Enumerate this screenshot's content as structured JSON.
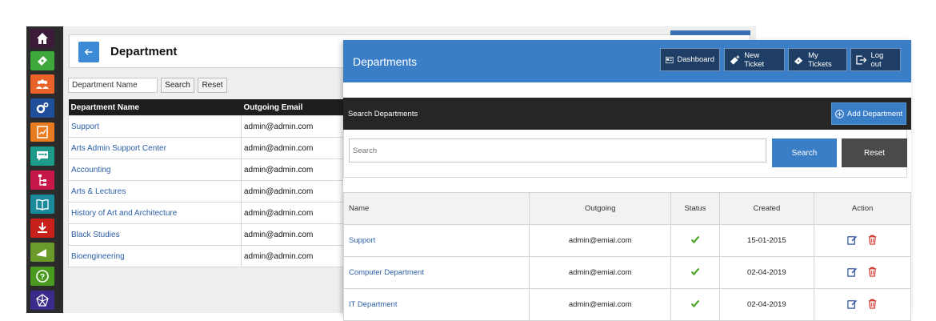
{
  "old_app": {
    "title": "Department",
    "search_placeholder": "Department Name",
    "search_label": "Search",
    "reset_label": "Reset",
    "columns": [
      "Department Name",
      "Outgoing Email"
    ],
    "rows": [
      {
        "name": "Support",
        "email": "admin@admin.com"
      },
      {
        "name": "Arts Admin Support Center",
        "email": "admin@admin.com"
      },
      {
        "name": "Accounting",
        "email": "admin@admin.com"
      },
      {
        "name": "Arts & Lectures",
        "email": "admin@admin.com"
      },
      {
        "name": "History of Art and Architecture",
        "email": "admin@admin.com"
      },
      {
        "name": "Black Studies",
        "email": "admin@admin.com"
      },
      {
        "name": "Bioengineering",
        "email": "admin@admin.com"
      }
    ]
  },
  "sidebar": {
    "items": [
      {
        "icon": "home-icon",
        "color": "#3b1a3a"
      },
      {
        "icon": "ticket-icon",
        "color": "#3ea83a"
      },
      {
        "icon": "users-icon",
        "color": "#e8622a"
      },
      {
        "icon": "settings-icon",
        "color": "#1f4f9a"
      },
      {
        "icon": "report-icon",
        "color": "#e87a20"
      },
      {
        "icon": "chat-icon",
        "color": "#1e9a8a"
      },
      {
        "icon": "hierarchy-icon",
        "color": "#c8184a"
      },
      {
        "icon": "book-icon",
        "color": "#1a8a9a"
      },
      {
        "icon": "download-icon",
        "color": "#c8201a"
      },
      {
        "icon": "announcement-icon",
        "color": "#6a9a2a"
      },
      {
        "icon": "help-icon",
        "color": "#4a9a20"
      },
      {
        "icon": "network-icon",
        "color": "#3a2a8a"
      }
    ]
  },
  "panel": {
    "title": "Departments",
    "nav": {
      "dashboard": "Dashboard",
      "new_ticket": "New Ticket",
      "my_tickets": "My Tickets",
      "logout": "Log out"
    },
    "search_title": "Search Departments",
    "add_label": "Add Department",
    "search_placeholder": "Search",
    "search_label": "Search",
    "reset_label": "Reset",
    "columns": {
      "name": "Name",
      "outgoing": "Outgoing",
      "status": "Status",
      "created": "Created",
      "action": "Action"
    },
    "rows": [
      {
        "name": "Support",
        "outgoing": "admin@emial.com",
        "created": "15-01-2015"
      },
      {
        "name": "Computer Department",
        "outgoing": "admin@emial.com",
        "created": "02-04-2019"
      },
      {
        "name": "IT Department",
        "outgoing": "admin@emial.com",
        "created": "02-04-2019"
      }
    ]
  },
  "colors": {
    "primary": "#3a7ec8",
    "dark_nav": "#1f3e66",
    "status_ok": "#4aa82a",
    "delete": "#d0302a",
    "edit": "#2a4f9a"
  }
}
